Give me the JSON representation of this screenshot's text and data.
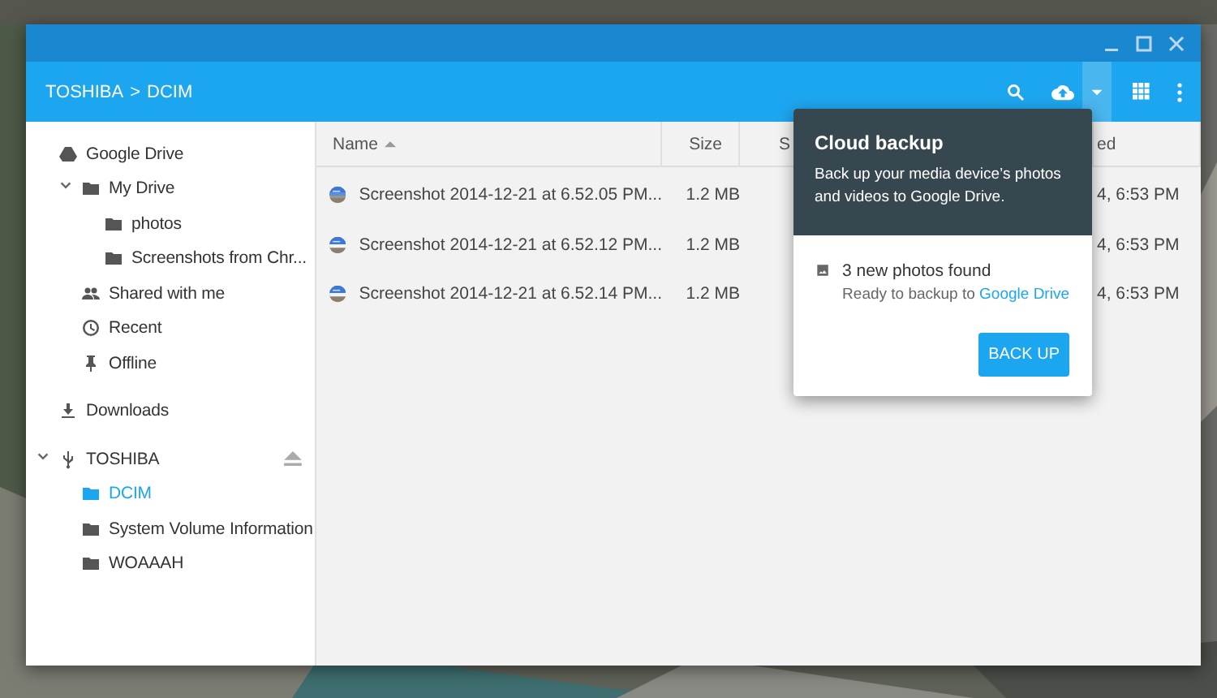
{
  "breadcrumb": {
    "items": [
      "TOSHIBA",
      "DCIM"
    ],
    "separator": ">"
  },
  "sidebar": {
    "groups": [
      {
        "items": [
          {
            "label": "Google Drive",
            "kind": "drive",
            "selected": false,
            "children": [
              {
                "label": "My Drive",
                "kind": "mydrive",
                "selected": false,
                "expanded": true,
                "children": [
                  {
                    "label": "photos",
                    "kind": "folder",
                    "selected": false
                  },
                  {
                    "label": "Screenshots from Chr...",
                    "kind": "folder",
                    "selected": false
                  }
                ]
              },
              {
                "label": "Shared with me",
                "kind": "shared",
                "selected": false
              },
              {
                "label": "Recent",
                "kind": "recent",
                "selected": false
              },
              {
                "label": "Offline",
                "kind": "offline",
                "selected": false
              }
            ]
          }
        ]
      },
      {
        "items": [
          {
            "label": "Downloads",
            "kind": "downloads",
            "selected": false
          }
        ]
      },
      {
        "items": [
          {
            "label": "TOSHIBA",
            "kind": "usb",
            "selected": false,
            "expanded": true,
            "eject": true,
            "children": [
              {
                "label": "DCIM",
                "kind": "folder",
                "selected": true
              },
              {
                "label": "System Volume Information",
                "kind": "folder",
                "selected": false
              },
              {
                "label": "WOAAAH",
                "kind": "folder",
                "selected": false
              }
            ]
          }
        ]
      }
    ]
  },
  "table": {
    "columns": [
      {
        "label": "Name",
        "sort_ascending": true
      },
      {
        "label": "Size"
      },
      {
        "label": "S"
      },
      {
        "label": "ed"
      }
    ],
    "rows": [
      {
        "name": "Screenshot 2014-12-21 at 6.52.05 PM...",
        "size": "1.2 MB",
        "column_4": "4, 6:53 PM"
      },
      {
        "name": "Screenshot 2014-12-21 at 6.52.12 PM...",
        "size": "1.2 MB",
        "column_4": "4, 6:53 PM"
      },
      {
        "name": "Screenshot 2014-12-21 at 6.52.14 PM...",
        "size": "1.2 MB",
        "column_4": "4, 6:53 PM"
      }
    ]
  },
  "popup": {
    "title": "Cloud backup",
    "description": "Back up your media device’s photos and videos to Google Drive.",
    "found": "3 new photos found",
    "ready_text": "Ready to backup to",
    "link": "Google Drive",
    "button": "BACK UP"
  }
}
